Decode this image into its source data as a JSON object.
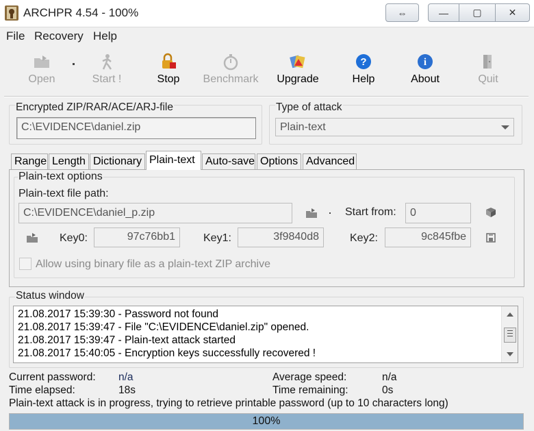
{
  "window": {
    "title": "ARCHPR 4.54 - 100%",
    "buttons": {
      "swap": "⇔",
      "minimize": "—",
      "maximize": "▢",
      "close": "✕"
    }
  },
  "menu": [
    "File",
    "Recovery",
    "Help"
  ],
  "toolbar": [
    {
      "label": "Open",
      "icon": "open-folder-icon",
      "enabled": false
    },
    {
      "label": "Start !",
      "icon": "start-figure-icon",
      "enabled": false
    },
    {
      "label": "Stop",
      "icon": "stop-lock-icon",
      "enabled": true
    },
    {
      "label": "Benchmark",
      "icon": "stopwatch-icon",
      "enabled": false
    },
    {
      "label": "Upgrade",
      "icon": "upgrade-icon",
      "enabled": true
    },
    {
      "label": "Help",
      "icon": "help-icon",
      "enabled": true
    },
    {
      "label": "About",
      "icon": "info-icon",
      "enabled": true
    },
    {
      "label": "Quit",
      "icon": "exit-door-icon",
      "enabled": false
    }
  ],
  "encrypted_file": {
    "label": "Encrypted ZIP/RAR/ACE/ARJ-file",
    "value": "C:\\EVIDENCE\\daniel.zip"
  },
  "attack_type": {
    "label": "Type of attack",
    "value": "Plain-text"
  },
  "tabs": [
    "Range",
    "Length",
    "Dictionary",
    "Plain-text",
    "Auto-save",
    "Options",
    "Advanced"
  ],
  "active_tab": "Plain-text",
  "plaintext": {
    "group_title": "Plain-text options",
    "path_label": "Plain-text file path:",
    "path_value": "C:\\EVIDENCE\\daniel_p.zip",
    "start_from_label": "Start from:",
    "start_from_value": "0",
    "key0_label": "Key0:",
    "key0_value": "97c76bb1",
    "key1_label": "Key1:",
    "key1_value": "3f9840d8",
    "key2_label": "Key2:",
    "key2_value": "9c845fbe",
    "binary_checkbox_label": "Allow using binary file as a plain-text ZIP archive",
    "binary_checked": false
  },
  "status": {
    "title": "Status window",
    "lines": [
      "21.08.2017 15:39:30 - Password not found",
      "21.08.2017 15:39:47 - File \"C:\\EVIDENCE\\daniel.zip\" opened.",
      "21.08.2017 15:39:47 - Plain-text attack started",
      "21.08.2017 15:40:05 - Encryption keys successfully recovered !"
    ]
  },
  "info": {
    "current_password_label": "Current password:",
    "current_password_value": "n/a",
    "time_elapsed_label": "Time elapsed:",
    "time_elapsed_value": "18s",
    "average_speed_label": "Average speed:",
    "average_speed_value": "n/a",
    "time_remaining_label": "Time remaining:",
    "time_remaining_value": "0s",
    "message": "Plain-text attack is in progress, trying to retrieve printable password (up to 10 characters long)"
  },
  "progress": {
    "text": "100%",
    "percent": 100
  },
  "colors": {
    "progress_fill": "#8fb1cc",
    "disabled_text": "#a0a0a0",
    "info_value": "#1a2b5a"
  }
}
